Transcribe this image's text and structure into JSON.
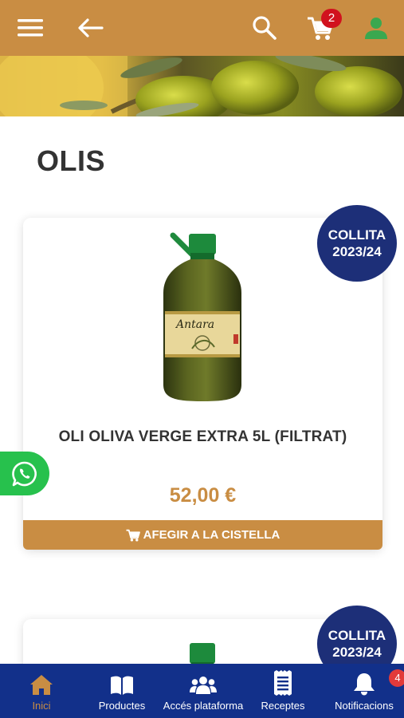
{
  "header": {
    "cart_count": "2",
    "icons": [
      "menu-icon",
      "back-arrow-icon",
      "search-icon",
      "cart-icon",
      "user-icon"
    ],
    "background": "#c98d43"
  },
  "page": {
    "title": "OLIS"
  },
  "products": [
    {
      "name": "OLI OLIVA VERGE EXTRA 5L (FILTRAT)",
      "price": "52,00 €",
      "badge_line1": "COLLITA",
      "badge_line2": "2023/24",
      "bottle_label": "Antara",
      "add_to_cart_label": "AFEGIR A LA CISTELLA"
    },
    {
      "badge_line1": "COLLITA",
      "badge_line2": "2023/24"
    }
  ],
  "bottom_nav": {
    "items": [
      {
        "label": "Inici",
        "icon": "home-icon",
        "active": true
      },
      {
        "label": "Productes",
        "icon": "book-icon"
      },
      {
        "label": "Accés plataforma",
        "icon": "users-icon"
      },
      {
        "label": "Receptes",
        "icon": "receipt-icon"
      },
      {
        "label": "Notificacions",
        "icon": "bell-icon",
        "count": "4"
      }
    ]
  },
  "colors": {
    "accent": "#c98d43",
    "navy": "#12308a",
    "badge": "#1d2f78",
    "whatsapp": "#27c14d",
    "cart_badge": "#d1121e",
    "user_icon": "#3aa84f"
  }
}
